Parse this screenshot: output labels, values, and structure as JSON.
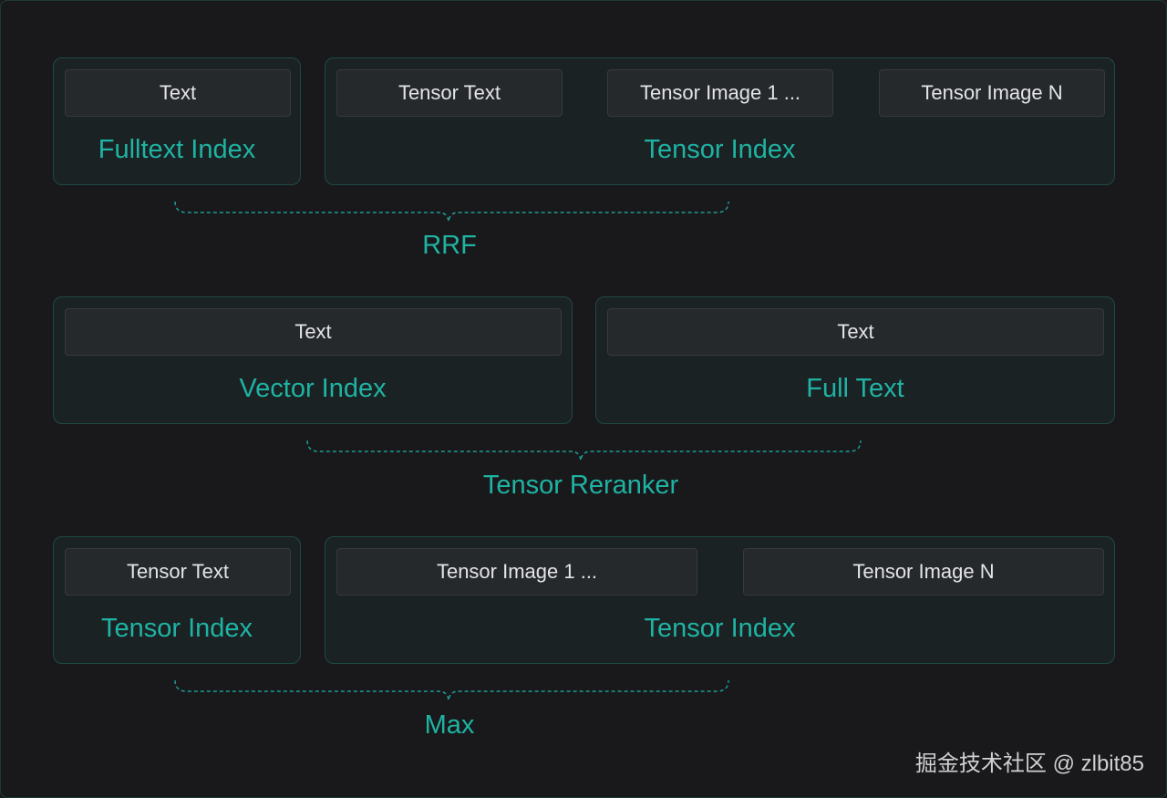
{
  "accent_color": "#1fb3a3",
  "rows": [
    {
      "panels": [
        {
          "chips": [
            "Text"
          ],
          "title": "Fulltext Index"
        },
        {
          "chips": [
            "Tensor Text",
            "Tensor Image 1 ...",
            "Tensor Image N"
          ],
          "title": "Tensor Index"
        }
      ],
      "merge_label": "RRF"
    },
    {
      "panels": [
        {
          "chips": [
            "Text"
          ],
          "title": "Vector Index"
        },
        {
          "chips": [
            "Text"
          ],
          "title": "Full Text"
        }
      ],
      "merge_label": "Tensor Reranker"
    },
    {
      "panels": [
        {
          "chips": [
            "Tensor Text"
          ],
          "title": "Tensor Index"
        },
        {
          "chips": [
            "Tensor Image 1 ...",
            "Tensor Image N"
          ],
          "title": "Tensor Index"
        }
      ],
      "merge_label": "Max"
    }
  ],
  "watermark": "掘金技术社区 @ zlbit85"
}
